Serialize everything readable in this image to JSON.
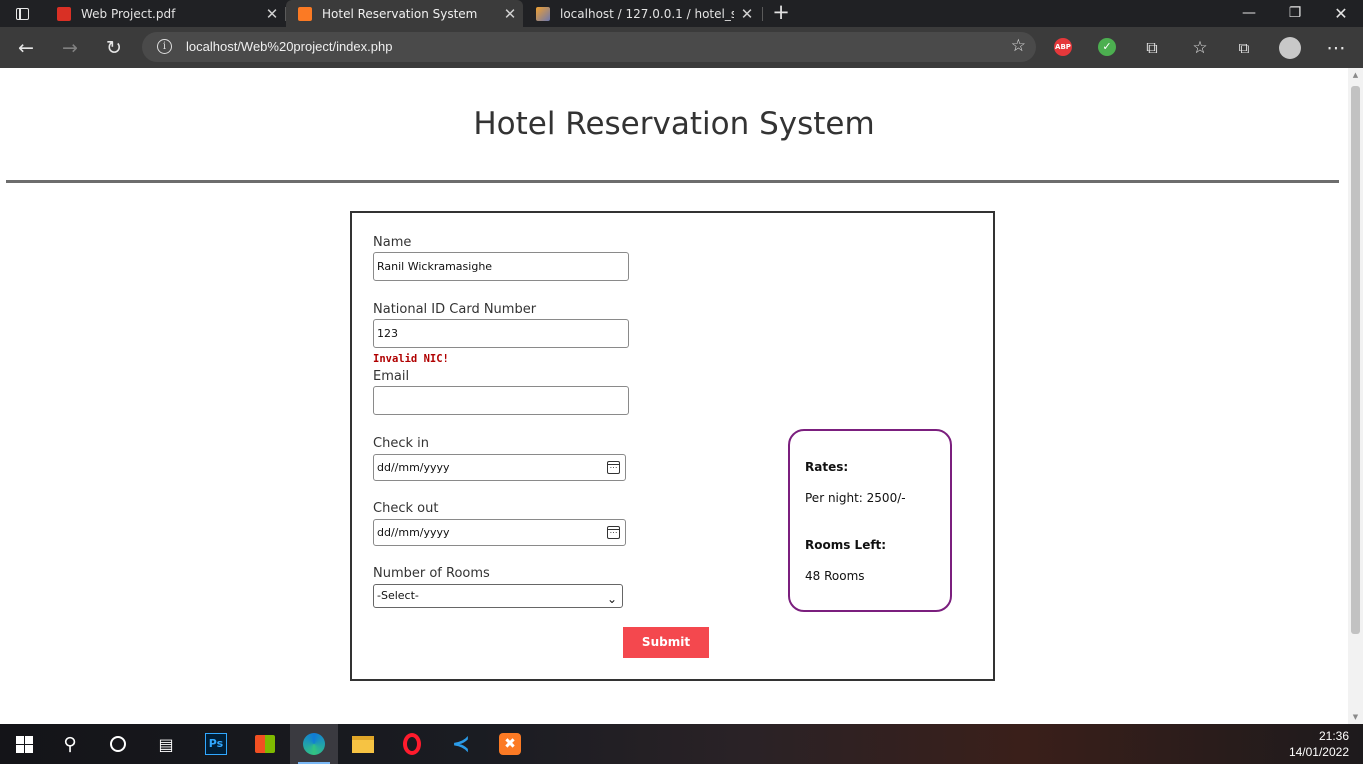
{
  "browser": {
    "tabs": [
      {
        "title": "Web Project.pdf",
        "icon": "pdf-icon",
        "active": false
      },
      {
        "title": "Hotel Reservation System",
        "icon": "xampp-icon",
        "active": true
      },
      {
        "title": "localhost / 127.0.0.1 / hotel_syste",
        "icon": "phpmyadmin-icon",
        "active": false
      }
    ],
    "url": "localhost/Web%20project/index.php",
    "extensions": [
      "adblock-plus-icon",
      "green-extension-icon",
      "puzzle-extensions-icon"
    ],
    "colors": {
      "titlebar": "#202124",
      "toolbar": "#3b3b3b",
      "adblock": "#e5383b",
      "green_ext": "#4caf50"
    }
  },
  "page": {
    "title": "Hotel Reservation System",
    "form": {
      "name_label": "Name",
      "name_value": "Ranil Wickramasighe",
      "nic_label": "National ID Card Number",
      "nic_value": "123",
      "nic_error": "Invalid NIC!",
      "email_label": "Email",
      "email_value": "",
      "checkin_label": "Check in",
      "checkin_value": "dd//mm/yyyy",
      "checkout_label": "Check out",
      "checkout_value": "dd//mm/yyyy",
      "rooms_label": "Number of Rooms",
      "rooms_selected": "-Select-",
      "submit_label": "Submit"
    },
    "rates": {
      "heading": "Rates:",
      "per_night": "Per night: 2500/-",
      "rooms_heading": "Rooms Left:",
      "rooms_value": "48 Rooms"
    },
    "colors": {
      "submit": "#f4484e",
      "error": "#b00000",
      "rates_border": "#7b1f7e"
    }
  },
  "taskbar": {
    "apps": [
      "windows-start-icon",
      "search-icon",
      "cortana-icon",
      "task-view-icon",
      "photoshop-icon",
      "store-icon",
      "edge-icon",
      "file-explorer-icon",
      "opera-icon",
      "vscode-icon",
      "xampp-icon"
    ],
    "time": "21:36",
    "date": "14/01/2022"
  }
}
